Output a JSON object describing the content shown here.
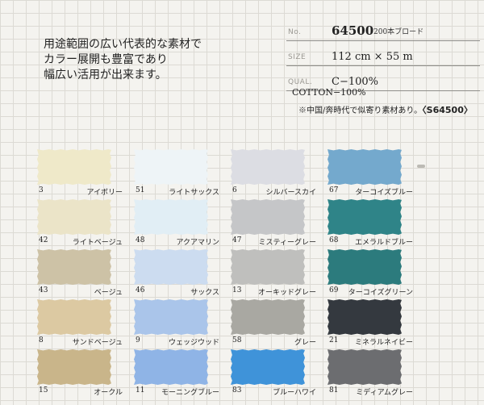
{
  "intro": [
    "用途範囲の広い代表的な素材で",
    "カラー展開も豊富であり",
    "幅広い活用が出来ます。"
  ],
  "spec": {
    "no_label": "No.",
    "no_value": "64500",
    "no_sub": "200本ブロード",
    "size_label": "SIZE",
    "size_value": "112 cm × 55 m",
    "qual_label": "QUAL.",
    "qual_value": "C−100%"
  },
  "content": "COTTON−100%",
  "note": {
    "text": "※中国/奔時代で似寄り素材あり。",
    "code": "〈S64500〉"
  },
  "swatches": [
    {
      "number": "3",
      "name": "アイボリー",
      "color": "#efe9c9"
    },
    {
      "number": "51",
      "name": "ライトサックス",
      "color": "#eef4f7"
    },
    {
      "number": "6",
      "name": "シルバースカイ",
      "color": "#dcdde3"
    },
    {
      "number": "67",
      "name": "ターコイズブルー",
      "color": "#74a9cd"
    },
    {
      "number": "42",
      "name": "ライトベージュ",
      "color": "#ebe4c8"
    },
    {
      "number": "48",
      "name": "アクアマリン",
      "color": "#e1eef5"
    },
    {
      "number": "47",
      "name": "ミスティーグレー",
      "color": "#c5c6c8"
    },
    {
      "number": "68",
      "name": "エメラルドブルー",
      "color": "#2f8488"
    },
    {
      "number": "43",
      "name": "ベージュ",
      "color": "#cdc2a6"
    },
    {
      "number": "46",
      "name": "サックス",
      "color": "#ccdcf0"
    },
    {
      "number": "13",
      "name": "オーキッドグレー",
      "color": "#bfbfbd"
    },
    {
      "number": "69",
      "name": "ターコイズグリーン",
      "color": "#2c7b7d"
    },
    {
      "number": "8",
      "name": "サンドベージュ",
      "color": "#dcc9a2"
    },
    {
      "number": "9",
      "name": "ウェッジウッド",
      "color": "#aac5ea"
    },
    {
      "number": "58",
      "name": "グレー",
      "color": "#a9a8a2"
    },
    {
      "number": "21",
      "name": "ミネラルネイビー",
      "color": "#34393f"
    },
    {
      "number": "15",
      "name": "オークル",
      "color": "#c9b58a"
    },
    {
      "number": "11",
      "name": "モーニングブルー",
      "color": "#8fb4e6"
    },
    {
      "number": "83",
      "name": "ブルーハワイ",
      "color": "#3f93d9"
    },
    {
      "number": "81",
      "name": "ミディアムグレー",
      "color": "#6c6d70"
    }
  ]
}
